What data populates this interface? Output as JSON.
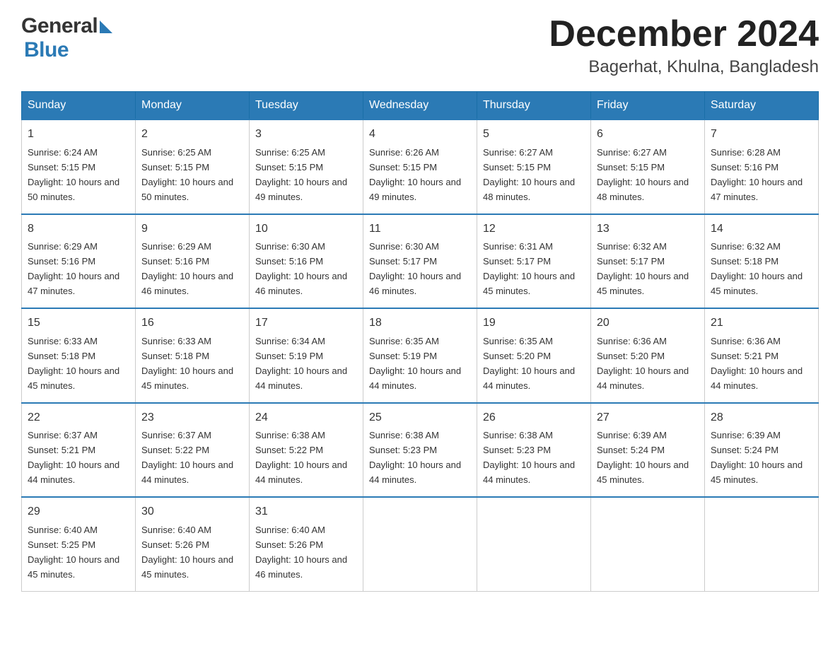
{
  "header": {
    "month_title": "December 2024",
    "location": "Bagerhat, Khulna, Bangladesh",
    "logo_general": "General",
    "logo_blue": "Blue"
  },
  "calendar": {
    "days_of_week": [
      "Sunday",
      "Monday",
      "Tuesday",
      "Wednesday",
      "Thursday",
      "Friday",
      "Saturday"
    ],
    "weeks": [
      [
        {
          "day": "1",
          "sunrise": "Sunrise: 6:24 AM",
          "sunset": "Sunset: 5:15 PM",
          "daylight": "Daylight: 10 hours and 50 minutes."
        },
        {
          "day": "2",
          "sunrise": "Sunrise: 6:25 AM",
          "sunset": "Sunset: 5:15 PM",
          "daylight": "Daylight: 10 hours and 50 minutes."
        },
        {
          "day": "3",
          "sunrise": "Sunrise: 6:25 AM",
          "sunset": "Sunset: 5:15 PM",
          "daylight": "Daylight: 10 hours and 49 minutes."
        },
        {
          "day": "4",
          "sunrise": "Sunrise: 6:26 AM",
          "sunset": "Sunset: 5:15 PM",
          "daylight": "Daylight: 10 hours and 49 minutes."
        },
        {
          "day": "5",
          "sunrise": "Sunrise: 6:27 AM",
          "sunset": "Sunset: 5:15 PM",
          "daylight": "Daylight: 10 hours and 48 minutes."
        },
        {
          "day": "6",
          "sunrise": "Sunrise: 6:27 AM",
          "sunset": "Sunset: 5:15 PM",
          "daylight": "Daylight: 10 hours and 48 minutes."
        },
        {
          "day": "7",
          "sunrise": "Sunrise: 6:28 AM",
          "sunset": "Sunset: 5:16 PM",
          "daylight": "Daylight: 10 hours and 47 minutes."
        }
      ],
      [
        {
          "day": "8",
          "sunrise": "Sunrise: 6:29 AM",
          "sunset": "Sunset: 5:16 PM",
          "daylight": "Daylight: 10 hours and 47 minutes."
        },
        {
          "day": "9",
          "sunrise": "Sunrise: 6:29 AM",
          "sunset": "Sunset: 5:16 PM",
          "daylight": "Daylight: 10 hours and 46 minutes."
        },
        {
          "day": "10",
          "sunrise": "Sunrise: 6:30 AM",
          "sunset": "Sunset: 5:16 PM",
          "daylight": "Daylight: 10 hours and 46 minutes."
        },
        {
          "day": "11",
          "sunrise": "Sunrise: 6:30 AM",
          "sunset": "Sunset: 5:17 PM",
          "daylight": "Daylight: 10 hours and 46 minutes."
        },
        {
          "day": "12",
          "sunrise": "Sunrise: 6:31 AM",
          "sunset": "Sunset: 5:17 PM",
          "daylight": "Daylight: 10 hours and 45 minutes."
        },
        {
          "day": "13",
          "sunrise": "Sunrise: 6:32 AM",
          "sunset": "Sunset: 5:17 PM",
          "daylight": "Daylight: 10 hours and 45 minutes."
        },
        {
          "day": "14",
          "sunrise": "Sunrise: 6:32 AM",
          "sunset": "Sunset: 5:18 PM",
          "daylight": "Daylight: 10 hours and 45 minutes."
        }
      ],
      [
        {
          "day": "15",
          "sunrise": "Sunrise: 6:33 AM",
          "sunset": "Sunset: 5:18 PM",
          "daylight": "Daylight: 10 hours and 45 minutes."
        },
        {
          "day": "16",
          "sunrise": "Sunrise: 6:33 AM",
          "sunset": "Sunset: 5:18 PM",
          "daylight": "Daylight: 10 hours and 45 minutes."
        },
        {
          "day": "17",
          "sunrise": "Sunrise: 6:34 AM",
          "sunset": "Sunset: 5:19 PM",
          "daylight": "Daylight: 10 hours and 44 minutes."
        },
        {
          "day": "18",
          "sunrise": "Sunrise: 6:35 AM",
          "sunset": "Sunset: 5:19 PM",
          "daylight": "Daylight: 10 hours and 44 minutes."
        },
        {
          "day": "19",
          "sunrise": "Sunrise: 6:35 AM",
          "sunset": "Sunset: 5:20 PM",
          "daylight": "Daylight: 10 hours and 44 minutes."
        },
        {
          "day": "20",
          "sunrise": "Sunrise: 6:36 AM",
          "sunset": "Sunset: 5:20 PM",
          "daylight": "Daylight: 10 hours and 44 minutes."
        },
        {
          "day": "21",
          "sunrise": "Sunrise: 6:36 AM",
          "sunset": "Sunset: 5:21 PM",
          "daylight": "Daylight: 10 hours and 44 minutes."
        }
      ],
      [
        {
          "day": "22",
          "sunrise": "Sunrise: 6:37 AM",
          "sunset": "Sunset: 5:21 PM",
          "daylight": "Daylight: 10 hours and 44 minutes."
        },
        {
          "day": "23",
          "sunrise": "Sunrise: 6:37 AM",
          "sunset": "Sunset: 5:22 PM",
          "daylight": "Daylight: 10 hours and 44 minutes."
        },
        {
          "day": "24",
          "sunrise": "Sunrise: 6:38 AM",
          "sunset": "Sunset: 5:22 PM",
          "daylight": "Daylight: 10 hours and 44 minutes."
        },
        {
          "day": "25",
          "sunrise": "Sunrise: 6:38 AM",
          "sunset": "Sunset: 5:23 PM",
          "daylight": "Daylight: 10 hours and 44 minutes."
        },
        {
          "day": "26",
          "sunrise": "Sunrise: 6:38 AM",
          "sunset": "Sunset: 5:23 PM",
          "daylight": "Daylight: 10 hours and 44 minutes."
        },
        {
          "day": "27",
          "sunrise": "Sunrise: 6:39 AM",
          "sunset": "Sunset: 5:24 PM",
          "daylight": "Daylight: 10 hours and 45 minutes."
        },
        {
          "day": "28",
          "sunrise": "Sunrise: 6:39 AM",
          "sunset": "Sunset: 5:24 PM",
          "daylight": "Daylight: 10 hours and 45 minutes."
        }
      ],
      [
        {
          "day": "29",
          "sunrise": "Sunrise: 6:40 AM",
          "sunset": "Sunset: 5:25 PM",
          "daylight": "Daylight: 10 hours and 45 minutes."
        },
        {
          "day": "30",
          "sunrise": "Sunrise: 6:40 AM",
          "sunset": "Sunset: 5:26 PM",
          "daylight": "Daylight: 10 hours and 45 minutes."
        },
        {
          "day": "31",
          "sunrise": "Sunrise: 6:40 AM",
          "sunset": "Sunset: 5:26 PM",
          "daylight": "Daylight: 10 hours and 46 minutes."
        },
        null,
        null,
        null,
        null
      ]
    ]
  }
}
